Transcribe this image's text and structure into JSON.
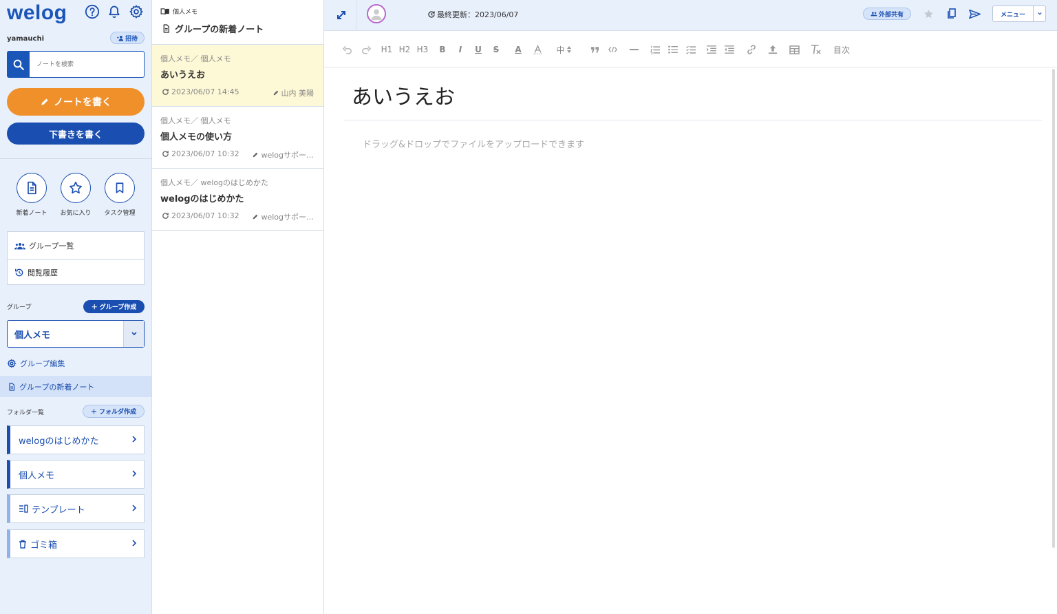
{
  "app": {
    "logo": "welog",
    "username": "yamauchi",
    "invite_label": "招待"
  },
  "sidebar": {
    "search_placeholder": "ノートを検索",
    "write_note_label": "ノートを書く",
    "write_draft_label": "下書きを書く",
    "quick": [
      {
        "label": "新着ノート",
        "icon": "document-icon"
      },
      {
        "label": "お気に入り",
        "icon": "star-icon"
      },
      {
        "label": "タスク管理",
        "icon": "bookmark-icon"
      }
    ],
    "nav": [
      {
        "label": "グループ一覧",
        "icon": "users-icon"
      },
      {
        "label": "閲覧履歴",
        "icon": "history-icon"
      }
    ],
    "group_label": "グループ",
    "group_create_label": "グループ作成",
    "group_selected": "個人メモ",
    "group_edit_label": "グループ編集",
    "group_new_notes_label": "グループの新着ノート",
    "folder_label": "フォルダ一覧",
    "folder_create_label": "フォルダ作成",
    "folders": [
      {
        "label": "welogのはじめかた"
      },
      {
        "label": "個人メモ"
      },
      {
        "label": "テンプレート"
      },
      {
        "label": "ゴミ箱"
      }
    ]
  },
  "list": {
    "crumb": "個人メモ",
    "title": "グループの新着ノート",
    "notes": [
      {
        "path": "個人メモ／ 個人メモ",
        "title": "あいうえお",
        "date": "2023/06/07 14:45",
        "author": "山内 美陽"
      },
      {
        "path": "個人メモ／ 個人メモ",
        "title": "個人メモの使い方",
        "date": "2023/06/07 10:32",
        "author": "welogサポー…"
      },
      {
        "path": "個人メモ／ welogのはじめかた",
        "title": "welogのはじめかた",
        "date": "2023/06/07 10:32",
        "author": "welogサポー…"
      }
    ]
  },
  "editor": {
    "last_updated": "最終更新：2023/06/07",
    "share_label": "外部共有",
    "menu_label": "メニュー",
    "toolbar": {
      "h1": "H1",
      "h2": "H2",
      "h3": "H3",
      "bold": "B",
      "italic": "I",
      "underline": "U",
      "strike": "S",
      "font_color": "A",
      "size": "中",
      "toc": "目次"
    },
    "doc_title": "あいうえお",
    "placeholder": "ドラッグ&ドロップでファイルをアップロードできます"
  },
  "colors": {
    "primary": "#1a4eb0",
    "accent": "#f0902a",
    "sidebar_bg": "#e8f0fc",
    "active_note_bg": "#fdf8d6"
  }
}
